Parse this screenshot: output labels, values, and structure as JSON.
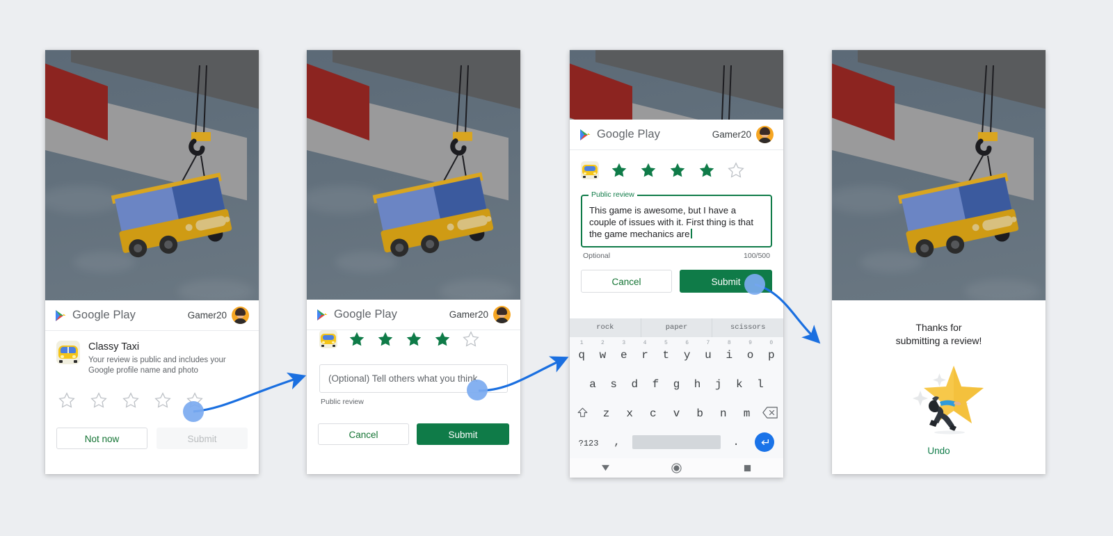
{
  "background_color": "#eceef1",
  "accent_colors": {
    "google_green": "#0f7b48",
    "link_green": "#137333",
    "tap_blue": "#7baaf0",
    "arrow_blue": "#1a6fe0",
    "star_gold": "#f7c84a",
    "sky_grey": "#5d6b78",
    "red_slab": "#8c2420"
  },
  "appbar": {
    "brand": "Google Play",
    "user_name": "Gamer20",
    "logo_icon": "google-play-icon",
    "avatar_icon": "user-avatar"
  },
  "panel1": {
    "app_name": "Classy Taxi",
    "app_subtitle": "Your review is public and includes your Google profile name and photo",
    "app_icon": "classy-taxi-app-icon",
    "stars": [
      {
        "filled": false
      },
      {
        "filled": false
      },
      {
        "filled": false
      },
      {
        "filled": false
      },
      {
        "filled": false
      }
    ],
    "buttons": {
      "secondary": "Not now",
      "primary": "Submit",
      "primary_disabled": true
    }
  },
  "panel2": {
    "stars": [
      {
        "filled": true
      },
      {
        "filled": true
      },
      {
        "filled": true
      },
      {
        "filled": true
      },
      {
        "filled": false
      }
    ],
    "input_placeholder": "(Optional) Tell others what you think",
    "helper_text": "Public review",
    "buttons": {
      "secondary": "Cancel",
      "primary": "Submit"
    }
  },
  "panel3": {
    "stars": [
      {
        "filled": true
      },
      {
        "filled": true
      },
      {
        "filled": true
      },
      {
        "filled": true
      },
      {
        "filled": false
      }
    ],
    "field_label": "Public review",
    "field_value": "This game is awesome, but I have a couple of issues with it. First thing is that the game mechanics are",
    "helper_text": "Optional",
    "char_counter": "100/500",
    "buttons": {
      "secondary": "Cancel",
      "primary": "Submit"
    },
    "keyboard": {
      "suggestions": [
        "rock",
        "paper",
        "scissors"
      ],
      "row1": [
        {
          "key": "q",
          "num": "1"
        },
        {
          "key": "w",
          "num": "2"
        },
        {
          "key": "e",
          "num": "3"
        },
        {
          "key": "r",
          "num": "4"
        },
        {
          "key": "t",
          "num": "5"
        },
        {
          "key": "y",
          "num": "6"
        },
        {
          "key": "u",
          "num": "7"
        },
        {
          "key": "i",
          "num": "8"
        },
        {
          "key": "o",
          "num": "9"
        },
        {
          "key": "p",
          "num": "0"
        }
      ],
      "row2": [
        "a",
        "s",
        "d",
        "f",
        "g",
        "h",
        "j",
        "k",
        "l"
      ],
      "row3": [
        "z",
        "x",
        "c",
        "v",
        "b",
        "n",
        "m"
      ],
      "shift_icon": "shift-arrow-icon",
      "backspace_icon": "backspace-icon",
      "symbols_key": "?123",
      "comma_key": ",",
      "period_key": ".",
      "space_key": "",
      "enter_icon": "enter-arrow-icon",
      "nav": {
        "back_icon": "keyboard-hide-triangle-icon",
        "home_icon": "home-circle-icon",
        "recents_icon": "recents-square-icon"
      }
    }
  },
  "panel4": {
    "thanks_line1": "Thanks for",
    "thanks_line2": "submitting a review!",
    "illustration": "person-pushing-star-illustration",
    "undo_label": "Undo"
  },
  "annotations": {
    "tap1": "tap-indicator-star-4",
    "tap2": "tap-indicator-review-field",
    "tap3": "tap-indicator-submit-button",
    "arrow1": "flow-arrow-panel1-to-panel2",
    "arrow2": "flow-arrow-panel2-to-panel3",
    "arrow3": "flow-arrow-panel3-to-panel4"
  }
}
